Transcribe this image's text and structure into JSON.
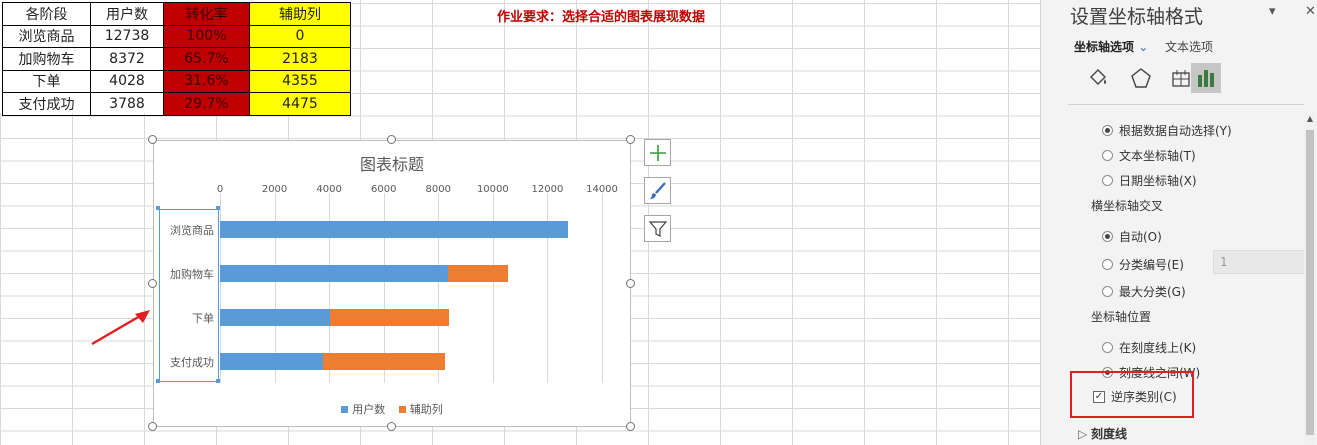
{
  "table": {
    "headers": [
      "各阶段",
      "用户数",
      "转化率",
      "辅助列"
    ],
    "rows": [
      [
        "浏览商品",
        "12738",
        "100%",
        "0"
      ],
      [
        "加购物车",
        "8372",
        "65.7%",
        "2183"
      ],
      [
        "下单",
        "4028",
        "31.6%",
        "4355"
      ],
      [
        "支付成功",
        "3788",
        "29.7%",
        "4475"
      ]
    ]
  },
  "note": "作业要求：选择合适的图表展现数据",
  "chart_data": {
    "type": "bar",
    "orientation": "horizontal",
    "stacked": true,
    "title": "图表标题",
    "categories": [
      "浏览商品",
      "加购物车",
      "下单",
      "支付成功"
    ],
    "series": [
      {
        "name": "用户数",
        "values": [
          12738,
          8372,
          4028,
          3788
        ],
        "color": "#5b9bd5"
      },
      {
        "name": "辅助列",
        "values": [
          0,
          2183,
          4355,
          4475
        ],
        "color": "#ed7d31"
      }
    ],
    "xlim": [
      0,
      14000
    ],
    "xticks": [
      "0",
      "2000",
      "4000",
      "6000",
      "8000",
      "10000",
      "12000",
      "14000"
    ],
    "x_axis_position": "top",
    "categories_reversed": true,
    "grid": true,
    "legend": "bottom"
  },
  "pane": {
    "title": "设置坐标轴格式",
    "tab_axis": "坐标轴选项",
    "tab_text": "文本选项",
    "axis_type_options": [
      {
        "label": "根据数据自动选择(Y)",
        "selected": true
      },
      {
        "label": "文本坐标轴(T)",
        "selected": false
      },
      {
        "label": "日期坐标轴(X)",
        "selected": false
      }
    ],
    "cross_label": "横坐标轴交叉",
    "cross_options": [
      {
        "label": "自动(O)",
        "selected": true
      },
      {
        "label": "分类编号(E)",
        "selected": false
      },
      {
        "label": "最大分类(G)",
        "selected": false
      }
    ],
    "category_number": "1",
    "position_label": "坐标轴位置",
    "position_options": [
      {
        "label": "在刻度线上(K)",
        "selected": false
      },
      {
        "label": "刻度线之间(W)",
        "selected": true
      }
    ],
    "reverse_label": "逆序类别(C)",
    "reverse_checked": true,
    "ticks_label": "刻度线"
  }
}
